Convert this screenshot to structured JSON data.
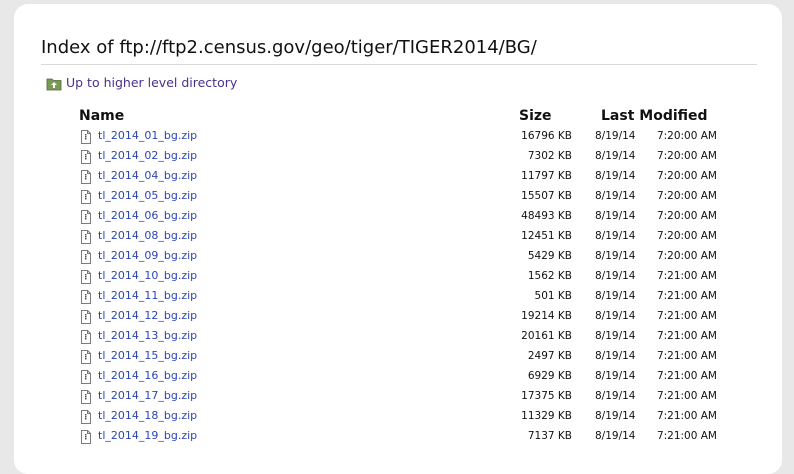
{
  "page": {
    "title": "Index of ftp://ftp2.census.gov/geo/tiger/TIGER2014/BG/",
    "up_link": "Up to higher level directory"
  },
  "table": {
    "headers": {
      "name": "Name",
      "size": "Size",
      "modified": "Last Modified"
    },
    "rows": [
      {
        "name": "tl_2014_01_bg.zip",
        "size": "16796 KB",
        "date": "8/19/14",
        "time": "7:20:00 AM"
      },
      {
        "name": "tl_2014_02_bg.zip",
        "size": "7302 KB",
        "date": "8/19/14",
        "time": "7:20:00 AM"
      },
      {
        "name": "tl_2014_04_bg.zip",
        "size": "11797 KB",
        "date": "8/19/14",
        "time": "7:20:00 AM"
      },
      {
        "name": "tl_2014_05_bg.zip",
        "size": "15507 KB",
        "date": "8/19/14",
        "time": "7:20:00 AM"
      },
      {
        "name": "tl_2014_06_bg.zip",
        "size": "48493 KB",
        "date": "8/19/14",
        "time": "7:20:00 AM"
      },
      {
        "name": "tl_2014_08_bg.zip",
        "size": "12451 KB",
        "date": "8/19/14",
        "time": "7:20:00 AM"
      },
      {
        "name": "tl_2014_09_bg.zip",
        "size": "5429 KB",
        "date": "8/19/14",
        "time": "7:20:00 AM"
      },
      {
        "name": "tl_2014_10_bg.zip",
        "size": "1562 KB",
        "date": "8/19/14",
        "time": "7:21:00 AM"
      },
      {
        "name": "tl_2014_11_bg.zip",
        "size": "501 KB",
        "date": "8/19/14",
        "time": "7:21:00 AM"
      },
      {
        "name": "tl_2014_12_bg.zip",
        "size": "19214 KB",
        "date": "8/19/14",
        "time": "7:21:00 AM"
      },
      {
        "name": "tl_2014_13_bg.zip",
        "size": "20161 KB",
        "date": "8/19/14",
        "time": "7:21:00 AM"
      },
      {
        "name": "tl_2014_15_bg.zip",
        "size": "2497 KB",
        "date": "8/19/14",
        "time": "7:21:00 AM"
      },
      {
        "name": "tl_2014_16_bg.zip",
        "size": "6929 KB",
        "date": "8/19/14",
        "time": "7:21:00 AM"
      },
      {
        "name": "tl_2014_17_bg.zip",
        "size": "17375 KB",
        "date": "8/19/14",
        "time": "7:21:00 AM"
      },
      {
        "name": "tl_2014_18_bg.zip",
        "size": "11329 KB",
        "date": "8/19/14",
        "time": "7:21:00 AM"
      },
      {
        "name": "tl_2014_19_bg.zip",
        "size": "7137 KB",
        "date": "8/19/14",
        "time": "7:21:00 AM"
      }
    ]
  },
  "icons": {
    "up": "folder-up-icon",
    "file": "file-icon"
  },
  "colors": {
    "link": "#2a44b8",
    "up_link": "#4a2f8c",
    "background": "#e8e8e8"
  }
}
